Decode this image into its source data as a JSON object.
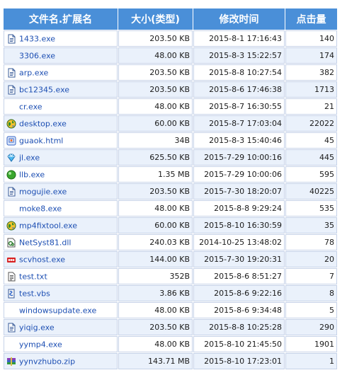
{
  "headers": {
    "name": "文件名.扩展名",
    "size": "大小(类型)",
    "time": "修改时间",
    "hits": "点击量"
  },
  "rows": [
    {
      "name": "1433.exe",
      "size": "203.50 KB",
      "time": "2015-8-1 17:16:43",
      "hits": "140",
      "icon": "document-icon"
    },
    {
      "name": "3306.exe",
      "size": "48.00 KB",
      "time": "2015-8-3 15:22:57",
      "hits": "174",
      "icon": "none"
    },
    {
      "name": "arp.exe",
      "size": "203.50 KB",
      "time": "2015-8-8 10:27:54",
      "hits": "382",
      "icon": "document-icon"
    },
    {
      "name": "bc12345.exe",
      "size": "203.50 KB",
      "time": "2015-8-6 17:46:38",
      "hits": "1713",
      "icon": "document-icon"
    },
    {
      "name": "cr.exe",
      "size": "48.00 KB",
      "time": "2015-8-7 16:30:55",
      "hits": "21",
      "icon": "none"
    },
    {
      "name": "desktop.exe",
      "size": "60.00 KB",
      "time": "2015-8-7 17:03:04",
      "hits": "22022",
      "icon": "globe-icon"
    },
    {
      "name": "guaok.html",
      "size": "34B",
      "time": "2015-8-3 15:40:46",
      "hits": "45",
      "icon": "html-icon"
    },
    {
      "name": "jl.exe",
      "size": "625.50 KB",
      "time": "2015-7-29 10:00:16",
      "hits": "445",
      "icon": "diamond-icon"
    },
    {
      "name": "llb.exe",
      "size": "1.35 MB",
      "time": "2015-7-29 10:00:06",
      "hits": "595",
      "icon": "green-orb-icon"
    },
    {
      "name": "mogujie.exe",
      "size": "203.50 KB",
      "time": "2015-7-30 18:20:07",
      "hits": "40225",
      "icon": "document-icon"
    },
    {
      "name": "moke8.exe",
      "size": "48.00 KB",
      "time": "2015-8-8 9:29:24",
      "hits": "535",
      "icon": "none"
    },
    {
      "name": "mp4fixtool.exe",
      "size": "60.00 KB",
      "time": "2015-8-10 16:30:59",
      "hits": "35",
      "icon": "globe-icon"
    },
    {
      "name": "NetSyst81.dll",
      "size": "240.03 KB",
      "time": "2014-10-25 13:48:02",
      "hits": "78",
      "icon": "dll-icon"
    },
    {
      "name": "scvhost.exe",
      "size": "144.00 KB",
      "time": "2015-7-30 19:20:31",
      "hits": "20",
      "icon": "red-app-icon"
    },
    {
      "name": "test.txt",
      "size": "352B",
      "time": "2015-8-6 8:51:27",
      "hits": "7",
      "icon": "text-file-icon"
    },
    {
      "name": "test.vbs",
      "size": "3.86 KB",
      "time": "2015-8-6 9:22:16",
      "hits": "8",
      "icon": "script-icon"
    },
    {
      "name": "windowsupdate.exe",
      "size": "48.00 KB",
      "time": "2015-8-6 9:34:48",
      "hits": "5",
      "icon": "none"
    },
    {
      "name": "yiqig.exe",
      "size": "203.50 KB",
      "time": "2015-8-8 10:25:28",
      "hits": "290",
      "icon": "document-icon"
    },
    {
      "name": "yymp4.exe",
      "size": "48.00 KB",
      "time": "2015-8-10 21:45:50",
      "hits": "1901",
      "icon": "none"
    },
    {
      "name": "yynvzhubo.zip",
      "size": "143.71 MB",
      "time": "2015-8-10 17:23:01",
      "hits": "1",
      "icon": "zip-archive-icon"
    }
  ],
  "colors": {
    "header_bg": "#4a8fd8",
    "link": "#1d4fb3",
    "alt_row": "#eaf1fb",
    "border": "#c6d2e8"
  }
}
